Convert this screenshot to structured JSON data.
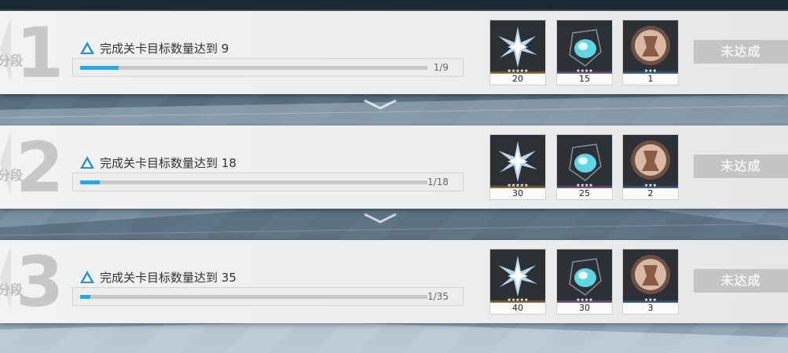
{
  "tiers": [
    {
      "number": "1",
      "stage_label": "分段",
      "task": "完成关卡目标数量达到 9",
      "progress": "1/9",
      "progress_fraction": 0.111,
      "status": "未达成",
      "rewards": [
        {
          "item": "blue-crystal-shard",
          "count": "20",
          "rarity_color": "#e6a83a",
          "stars": "★★★★★"
        },
        {
          "item": "cyan-gem",
          "count": "15",
          "rarity_color": "#b27be0",
          "stars": "★★★★"
        },
        {
          "item": "coin-emblem",
          "count": "1",
          "rarity_color": "#4d8fe0",
          "stars": "★★★"
        }
      ]
    },
    {
      "number": "2",
      "stage_label": "分段",
      "task": "完成关卡目标数量达到 18",
      "progress": "1/18",
      "progress_fraction": 0.056,
      "status": "未达成",
      "rewards": [
        {
          "item": "blue-crystal-shard",
          "count": "30",
          "rarity_color": "#e6a83a",
          "stars": "★★★★★"
        },
        {
          "item": "cyan-gem",
          "count": "25",
          "rarity_color": "#b27be0",
          "stars": "★★★★"
        },
        {
          "item": "coin-emblem",
          "count": "2",
          "rarity_color": "#4d8fe0",
          "stars": "★★★"
        }
      ]
    },
    {
      "number": "3",
      "stage_label": "分段",
      "task": "完成关卡目标数量达到 35",
      "progress": "1/35",
      "progress_fraction": 0.029,
      "status": "未达成",
      "rewards": [
        {
          "item": "blue-crystal-shard",
          "count": "40",
          "rarity_color": "#e6a83a",
          "stars": "★★★★★"
        },
        {
          "item": "cyan-gem",
          "count": "30",
          "rarity_color": "#b27be0",
          "stars": "★★★★"
        },
        {
          "item": "coin-emblem",
          "count": "3",
          "rarity_color": "#4d8fe0",
          "stars": "★★★"
        }
      ]
    }
  ],
  "colors": {
    "accent": "#25a8ea",
    "button_disabled": "#c4c4c4"
  }
}
